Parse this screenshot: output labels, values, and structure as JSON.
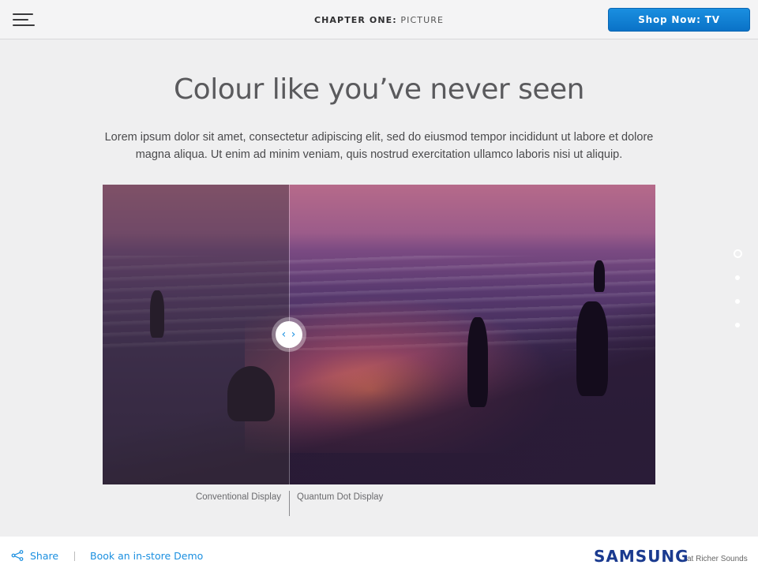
{
  "header": {
    "chapter_label": "CHAPTER ONE",
    "chapter_separator": ":",
    "chapter_name": "PICTURE",
    "shop_button_label": "Shop Now: TV",
    "accent_color": "#1a8fe0"
  },
  "main": {
    "title": "Colour like you’ve never seen",
    "lead": "Lorem ipsum dolor sit amet, consectetur adipiscing elit, sed do eiusmod tempor incididunt ut labore et dolore magna aliqua. Ut enim ad minim veniam, quis nostrud exercitation ullamco laboris nisi ut aliquip.",
    "comparison": {
      "handle_glyph": "‹ ›",
      "left_caption": "Conventional Display",
      "right_caption": "Quantum Dot Display"
    }
  },
  "pagination": {
    "dots": 4,
    "active_index": 0
  },
  "footer": {
    "share_label": "Share",
    "book_label": "Book an in-store Demo",
    "brand": "SAMSUNG",
    "brand_sub": "at Richer Sounds"
  }
}
